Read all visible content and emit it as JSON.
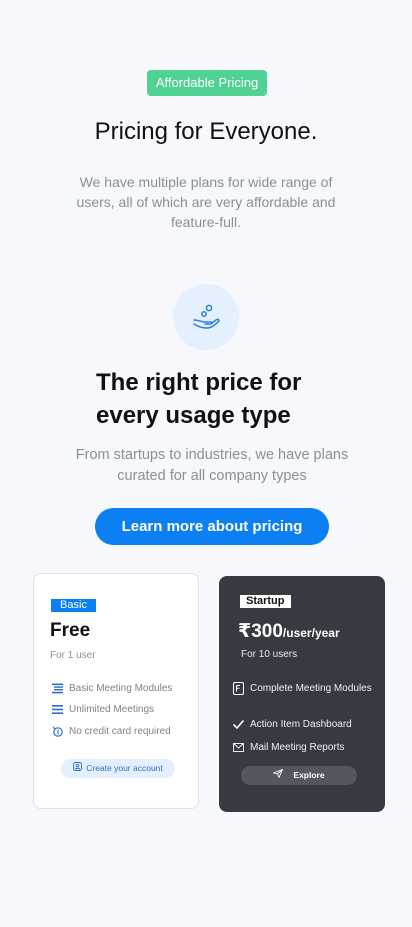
{
  "hero": {
    "badge": "Affordable Pricing",
    "title": "Pricing for Everyone.",
    "subtitle": "We have multiple plans for wide range of users, all of which are very affordable and feature-full."
  },
  "section": {
    "icon": "hand-coins-icon",
    "heading": "The right price for every usage type",
    "subtext": "From startups to industries, we have plans curated for all company types",
    "cta_label": "Learn more about pricing"
  },
  "plans": {
    "basic": {
      "tag": "Basic",
      "name": "Free",
      "users": "For 1 user",
      "features": [
        {
          "label": "Basic Meeting Modules",
          "icon": "modules-icon"
        },
        {
          "label": "Unlimited Meetings",
          "icon": "list-icon"
        },
        {
          "label": "No credit card required",
          "icon": "dollar-icon"
        }
      ],
      "button_label": "Create your account"
    },
    "startup": {
      "tag": "Startup",
      "price": "₹300",
      "price_unit": "/user/year",
      "users": "For 10 users",
      "features": [
        {
          "label": "Complete Meeting Modules",
          "icon": "document-icon"
        },
        {
          "label": "Action Item Dashboard",
          "icon": "check-icon"
        },
        {
          "label": "Mail Meeting Reports",
          "icon": "mail-icon"
        }
      ],
      "button_label": "Explore"
    }
  },
  "colors": {
    "background": "#f6f8fb",
    "accent_green": "#4fd293",
    "accent_blue": "#0c7ff2",
    "dark_card": "#373a40"
  }
}
